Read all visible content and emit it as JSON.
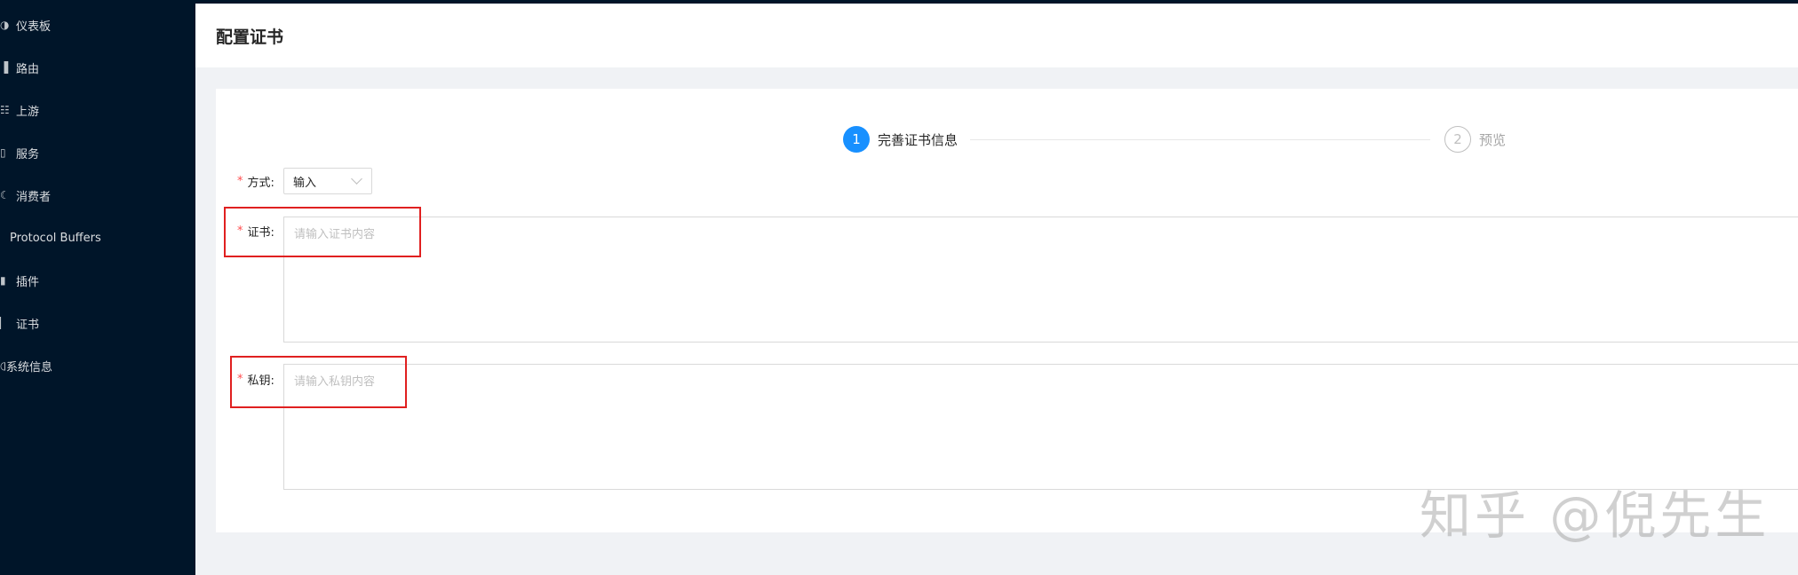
{
  "sidebar": {
    "items": [
      {
        "label": "仪表板",
        "icon": "dashboard-icon"
      },
      {
        "label": "路由",
        "icon": "route-icon"
      },
      {
        "label": "上游",
        "icon": "upstream-icon"
      },
      {
        "label": "服务",
        "icon": "service-icon"
      },
      {
        "label": "消费者",
        "icon": "consumer-icon"
      },
      {
        "label": "Protocol Buffers",
        "icon": ""
      },
      {
        "label": "插件",
        "icon": "plugin-icon"
      },
      {
        "label": "证书",
        "icon": "certificate-icon"
      },
      {
        "label": "系统信息",
        "icon": "info-icon"
      }
    ]
  },
  "header": {
    "title": "配置证书"
  },
  "steps": [
    {
      "number": "1",
      "title": "完善证书信息",
      "status": "active"
    },
    {
      "number": "2",
      "title": "预览",
      "status": "wait"
    }
  ],
  "form": {
    "method": {
      "label": "方式:",
      "value": "输入"
    },
    "certificate": {
      "label": "证书:",
      "placeholder": "请输入证书内容"
    },
    "private_key": {
      "label": "私钥:",
      "placeholder": "请输入私钥内容"
    }
  },
  "watermark": "知乎 @倪先生",
  "colors": {
    "sidebar_bg": "#001529",
    "primary": "#1890ff",
    "required": "#ff4d4f",
    "highlight": "#e02020"
  }
}
